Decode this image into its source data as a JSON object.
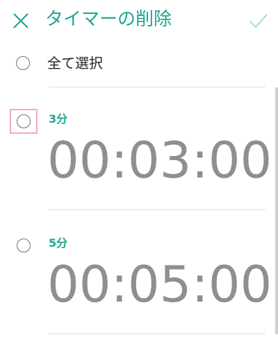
{
  "header": {
    "title": "タイマーの削除",
    "close_icon": "close-icon",
    "confirm_icon": "checkmark-icon"
  },
  "select_all": {
    "label": "全て選択",
    "checked": false
  },
  "timers": [
    {
      "name": "3分",
      "time": "00:03:00",
      "checked": false,
      "highlighted": true
    },
    {
      "name": "5分",
      "time": "00:05:00",
      "checked": false,
      "highlighted": false
    }
  ],
  "colors": {
    "accent": "#1aa692",
    "time_text": "#8f8f8f",
    "highlight_frame": "#f3a9c2",
    "divider": "#dcdcdc"
  }
}
